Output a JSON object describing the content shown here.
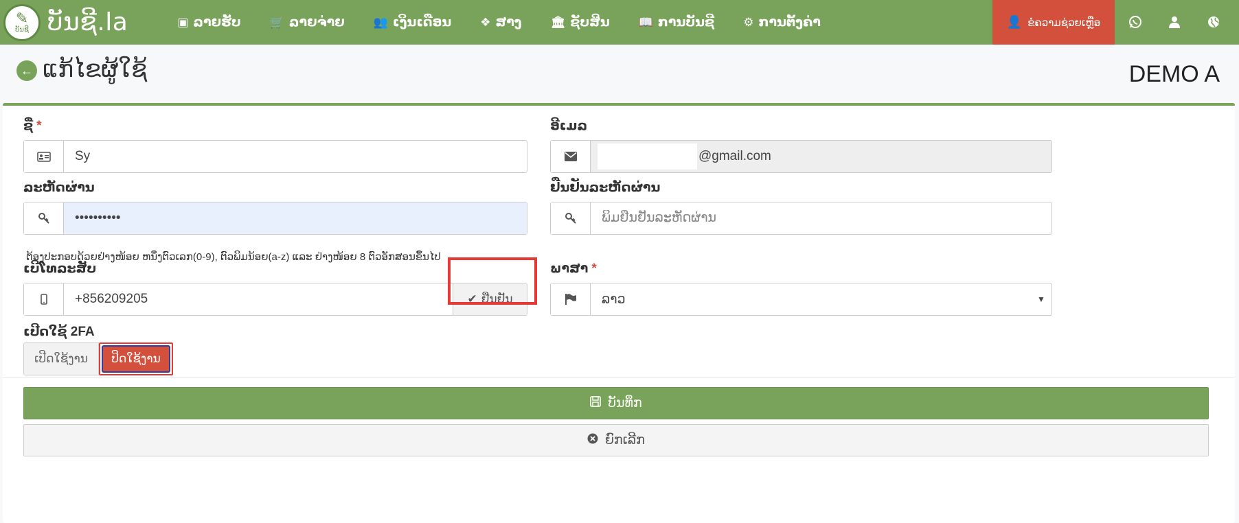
{
  "nav": {
    "brand": "ບັນຊີ.la",
    "brand_logo_text": "ບັນຊີ",
    "items": [
      {
        "label": "ລາຍຮັບ",
        "icon": "money-icon",
        "glyph": "▣"
      },
      {
        "label": "ລາຍຈ່າຍ",
        "icon": "cart-icon",
        "glyph": "🛒"
      },
      {
        "label": "ເງິນເດືອນ",
        "icon": "users-icon",
        "glyph": "👥"
      },
      {
        "label": "ສາງ",
        "icon": "box-icon",
        "glyph": "❖"
      },
      {
        "label": "ຊັບສິນ",
        "icon": "bank-icon",
        "glyph": "🏛"
      },
      {
        "label": "ການບັນຊີ",
        "icon": "book-icon",
        "glyph": "📖"
      },
      {
        "label": "ການຕັ້ງຄ່າ",
        "icon": "cogs-icon",
        "glyph": "⚙"
      }
    ],
    "help_label": "ຂໍຄວາມຊ່ວຍເຫຼືອ",
    "help_color": "#d3503d",
    "accent_color": "#79a35a"
  },
  "header": {
    "title": "ແກ້ໄຂຜູ້ໃຊ້",
    "company": "DEMO A"
  },
  "form": {
    "name_label": "ຊື່",
    "name_value": "Sy",
    "email_label": "ອີເມລ",
    "email_value": "@gmail.com",
    "password_label": "ລະຫັດຜ່ານ",
    "password_value": "••••••••••",
    "confirm_label": "ຢືນຢັນລະຫັດຜ່ານ",
    "confirm_placeholder": "ພິມຢືນຢັນລະຫັດຜ່ານ",
    "password_hint": "ຕ້ອງປະກອບດ້ວຍຢ່າງໜ້ອຍ ຫນຶ່ງຕົວເລກ(0-9), ຕົວພິມນ້ອຍ(a-z) ແລະ ຢ່າງໜ້ອຍ 8 ຕົວອັກສອນຂຶ້ນໄປ",
    "phone_label": "ເບີໂທລະສັບ",
    "phone_value": "+856209205",
    "verify_label": "ຢືນຢັນ",
    "language_label": "ພາສາ",
    "language_value": "ລາວ",
    "twofa_label": "ເປີດໃຊ້ 2FA",
    "twofa_on_label": "ເປີດໃຊ້ງານ",
    "twofa_off_label": "ປິດໃຊ້ງານ",
    "required_mark": "*"
  },
  "actions": {
    "save_label": "ບັນທຶກ",
    "cancel_label": "ຍົກເລີກ"
  }
}
